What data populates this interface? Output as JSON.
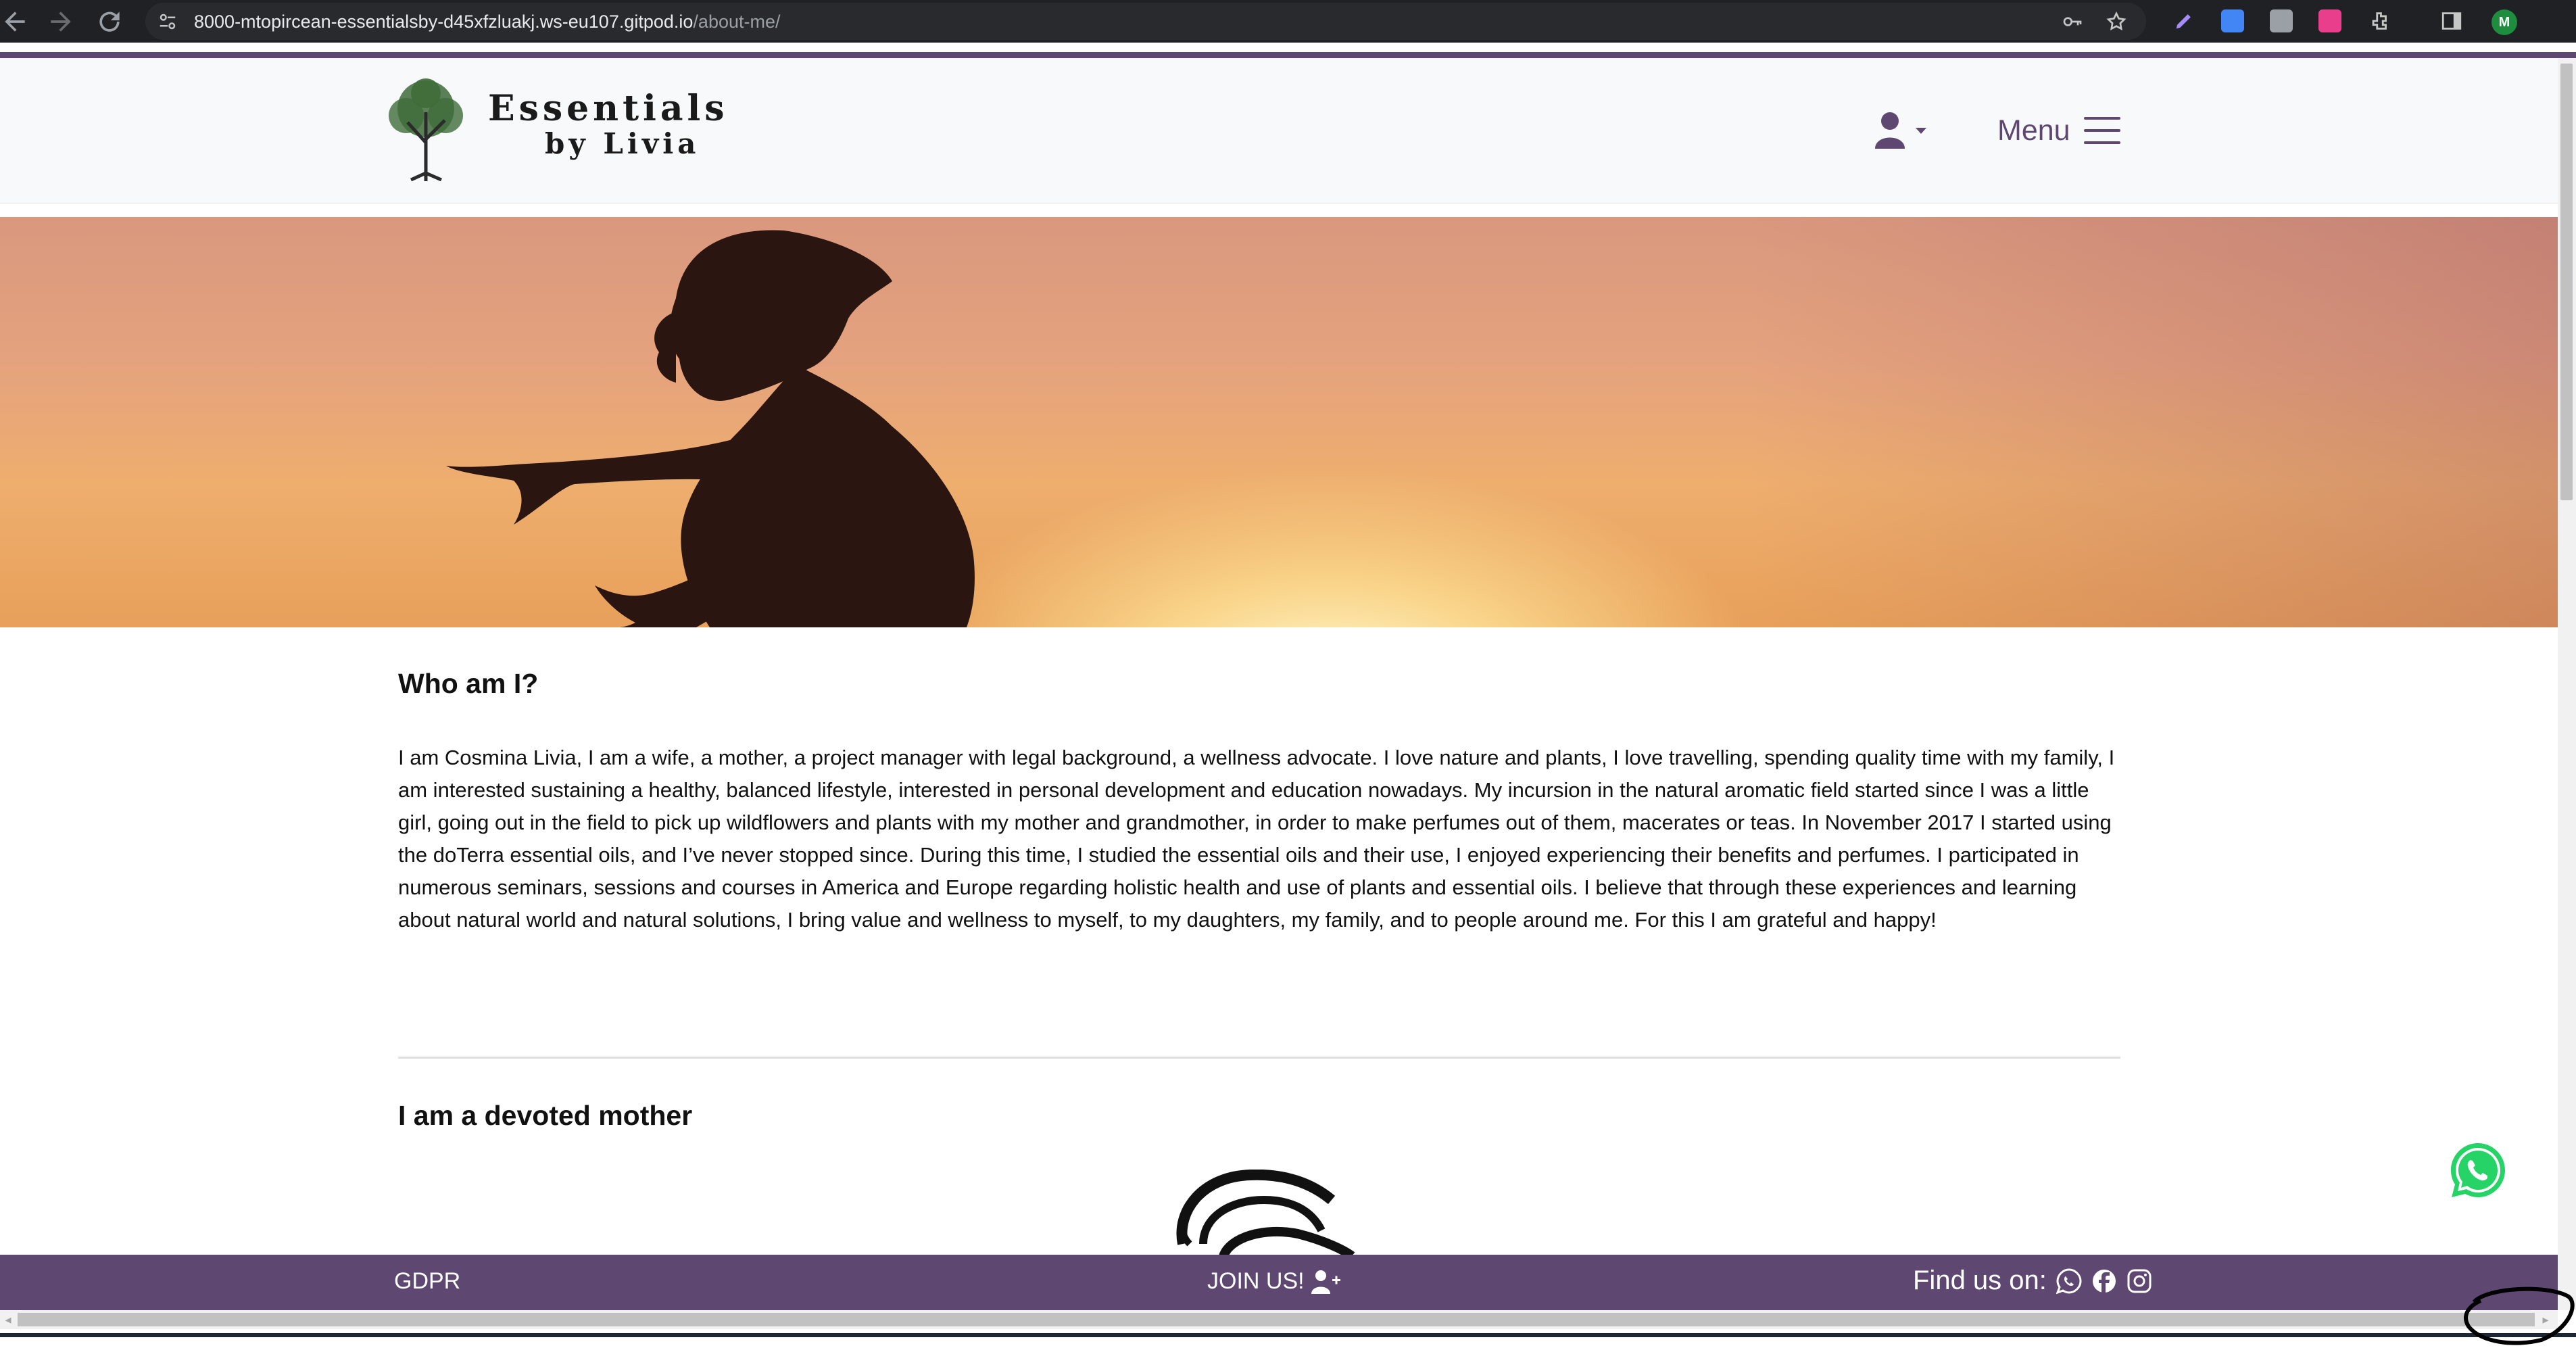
{
  "browser": {
    "url_host": "8000-mtopircean-essentialsby-d45xfzluakj.ws-eu107.gitpod.io",
    "url_path": "/about-me/",
    "profile_initial": "M"
  },
  "header": {
    "logo_line1": "Essentials",
    "logo_line2": "by Livia",
    "menu_label": "Menu"
  },
  "about": {
    "heading": "Who am I?",
    "paragraph": "I am Cosmina Livia, I am a wife, a mother, a project manager with legal background, a wellness advocate. I love nature and plants, I love travelling, spending quality time with my family, I am interested sustaining a healthy, balanced lifestyle, interested in personal development and education nowadays. My incursion in the natural aromatic field started since I was a little girl, going out in the field to pick up wildflowers and plants with my mother and grandmother, in order to make perfumes out of them, macerates or teas. In November 2017 I started using the doTerra essential oils, and I’ve never stopped since. During this time, I studied the essential oils and their use, I enjoyed experiencing their benefits and perfumes. I participated in numerous seminars, sessions and courses in America and Europe regarding holistic health and use of plants and essential oils. I believe that through these experiences and learning about natural world and natural solutions, I bring value and wellness to myself, to my daughters, my family, and to people around me. For this I am grateful and happy!",
    "section2_heading": "I am a devoted mother"
  },
  "footer": {
    "gdpr": "GDPR",
    "join": "JOIN US!",
    "find": "Find us on:"
  },
  "colors": {
    "brand": "#5e4872",
    "whatsapp": "#25d366"
  },
  "icons": [
    "back-arrow-icon",
    "forward-arrow-icon",
    "reload-icon",
    "site-info-icon",
    "key-icon",
    "star-icon",
    "user-icon",
    "caret-down-icon",
    "hamburger-icon",
    "whatsapp-icon",
    "user-plus-icon",
    "facebook-icon",
    "instagram-icon"
  ]
}
